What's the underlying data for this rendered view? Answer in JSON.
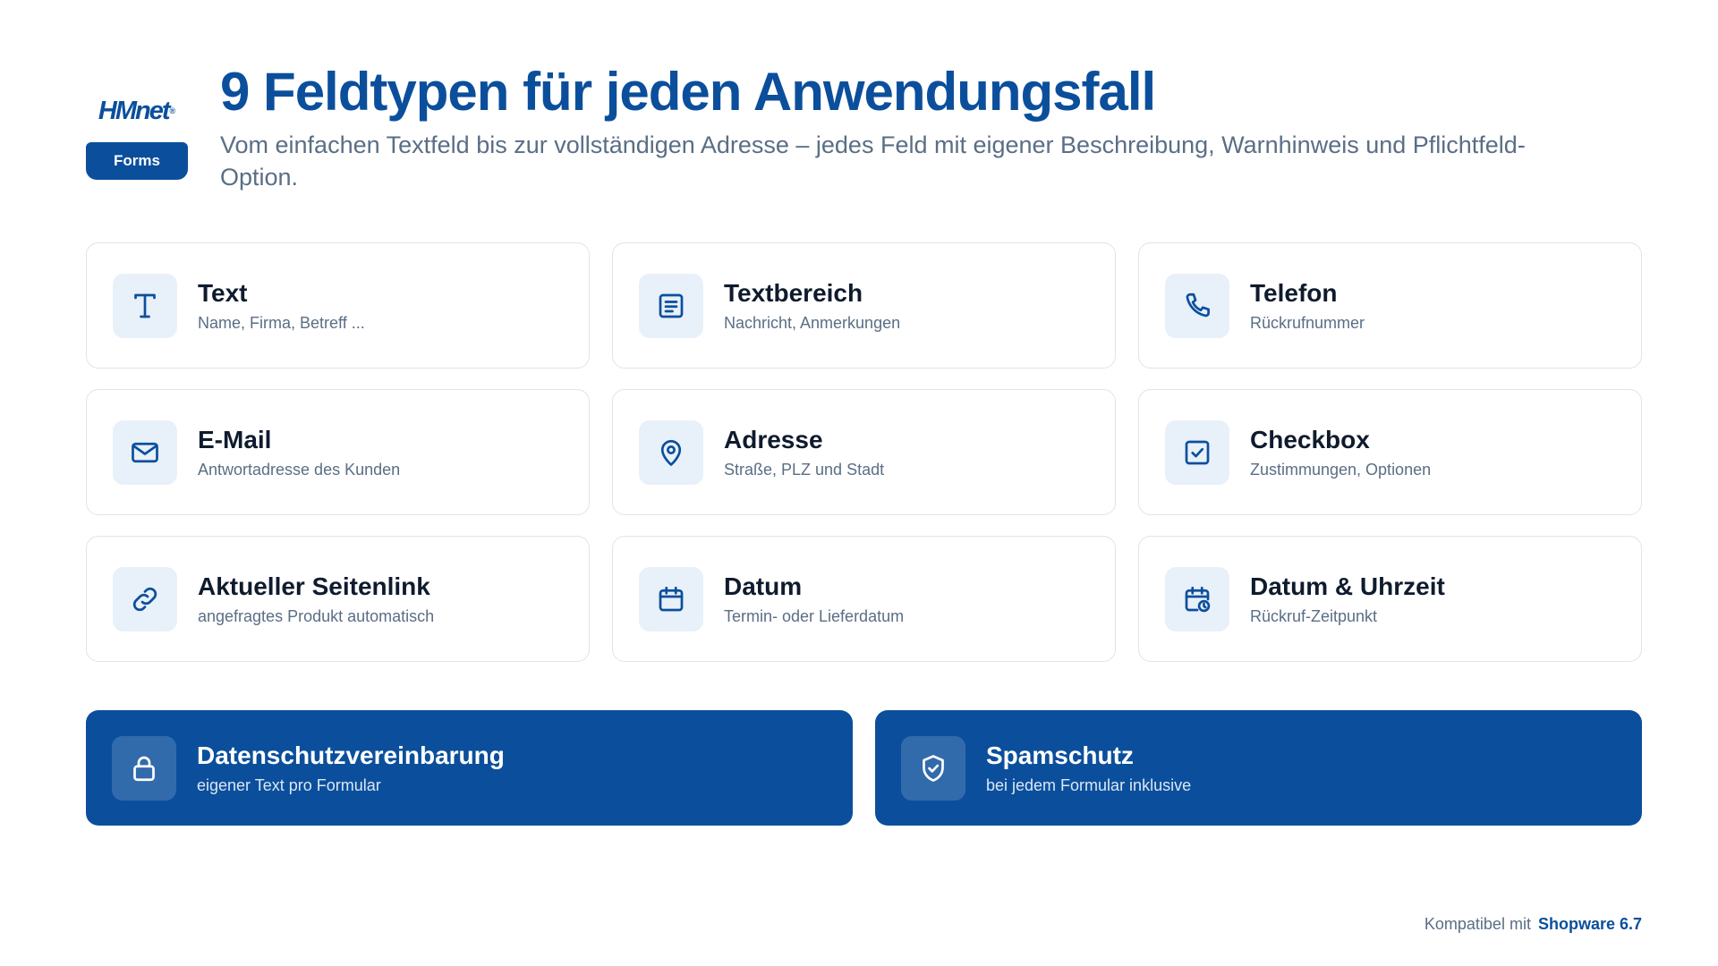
{
  "logo": {
    "wordmark": "HMnet",
    "registered": "®",
    "badge": "Forms"
  },
  "header": {
    "title": "9 Feldtypen für jeden Anwendungsfall",
    "subtitle": "Vom einfachen Textfeld bis zur vollständigen Adresse – jedes Feld mit eigener Beschreibung, Warnhinweis und Pflichtfeld-Option."
  },
  "fields": [
    {
      "title": "Text",
      "desc": "Name, Firma, Betreff ...",
      "icon": "text-icon"
    },
    {
      "title": "Textbereich",
      "desc": "Nachricht, Anmerkungen",
      "icon": "textarea-icon"
    },
    {
      "title": "Telefon",
      "desc": "Rückrufnummer",
      "icon": "phone-icon"
    },
    {
      "title": "E-Mail",
      "desc": "Antwortadresse des Kunden",
      "icon": "mail-icon"
    },
    {
      "title": "Adresse",
      "desc": "Straße, PLZ und Stadt",
      "icon": "map-pin-icon"
    },
    {
      "title": "Checkbox",
      "desc": "Zustimmungen, Optionen",
      "icon": "checkbox-icon"
    },
    {
      "title": "Aktueller Seitenlink",
      "desc": "angefragtes Produkt automatisch",
      "icon": "link-icon"
    },
    {
      "title": "Datum",
      "desc": "Termin- oder Lieferdatum",
      "icon": "calendar-icon"
    },
    {
      "title": "Datum & Uhrzeit",
      "desc": "Rückruf-Zeitpunkt",
      "icon": "calendar-clock-icon"
    }
  ],
  "features": [
    {
      "title": "Datenschutzvereinbarung",
      "desc": "eigener Text pro Formular",
      "icon": "lock-icon"
    },
    {
      "title": "Spamschutz",
      "desc": "bei jedem Formular inklusive",
      "icon": "shield-check-icon"
    }
  ],
  "footer": {
    "label": "Kompatibel mit",
    "brand": "Shopware 6.7"
  },
  "colors": {
    "primary": "#0b4f9c",
    "icon_bg": "#e8f0f9",
    "muted_text": "#5a6e85",
    "border": "#dfe4ea"
  }
}
